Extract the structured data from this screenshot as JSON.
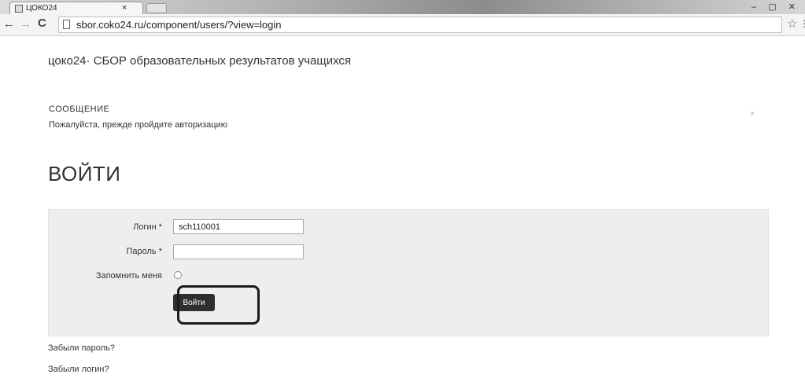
{
  "browser": {
    "tab_title": "ЦОКО24",
    "tab_close": "×",
    "url": "sbor.coko24.ru/component/users/?view=login",
    "window_controls": "– ▢ ✕"
  },
  "page": {
    "site_title": "цоко24· СБОР образовательных результатов учащихся",
    "message": {
      "heading": "СООБЩЕНИЕ",
      "text": "Пожалуйста, прежде пройдите авторизацию",
      "close": "×"
    },
    "login_heading": "ВОЙТИ",
    "form": {
      "login_label": "Логин *",
      "login_value": "sch110001",
      "password_label": "Пароль *",
      "password_value": "",
      "remember_label": "Запомнить меня",
      "submit_label": "Войти"
    },
    "links": {
      "forgot_password": "Забыли пароль?",
      "forgot_login": "Забыли логин?"
    }
  },
  "icons": {
    "back": "back-arrow-icon",
    "forward": "forward-arrow-icon",
    "reload": "reload-icon",
    "bookmark": "star-icon"
  }
}
